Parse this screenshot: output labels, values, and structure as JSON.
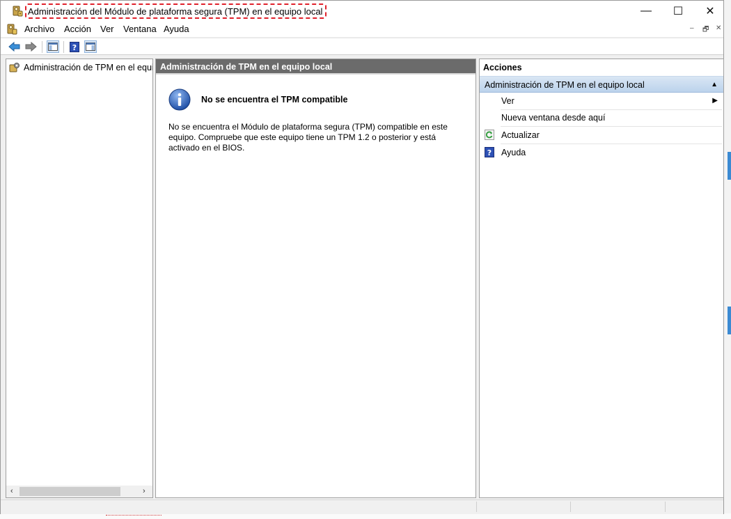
{
  "window": {
    "title": "Administración del Módulo de plataforma segura (TPM) en el equipo local",
    "controls": {
      "minimize": "—",
      "maximize": "☐",
      "close": "✕"
    }
  },
  "menu": {
    "items": [
      "Archivo",
      "Acción",
      "Ver",
      "Ventana",
      "Ayuda"
    ],
    "mdi": {
      "minimize": "–",
      "restore": "🗗",
      "close": "✕"
    }
  },
  "toolbar": {
    "icons": [
      "back-icon",
      "forward-icon",
      "show-hide-console-tree-icon",
      "help-icon",
      "show-hide-action-pane-icon"
    ]
  },
  "tree": {
    "root_label": "Administración de TPM en el equipo local",
    "scroll_left": "‹",
    "scroll_right": "›"
  },
  "center": {
    "header": "Administración de TPM en el equipo local",
    "info_title": "No se encuentra el TPM compatible",
    "info_body": "No se encuentra el Módulo de plataforma segura (TPM) compatible en este equipo. Compruebe que este equipo tiene un TPM 1.2 o posterior y está activado en el BIOS."
  },
  "actions": {
    "header": "Acciones",
    "group": "Administración de TPM en el equipo local",
    "items": [
      {
        "label": "Ver",
        "has_submenu": true
      },
      {
        "label": "Nueva ventana desde aquí",
        "has_submenu": false
      },
      {
        "label": "Actualizar",
        "icon": "refresh-icon"
      },
      {
        "label": "Ayuda",
        "icon": "help-icon"
      }
    ]
  },
  "colors": {
    "title_highlight": "#e0202a",
    "pane_header": "#6b6b6b",
    "actions_group": "#bcd3ec",
    "info_icon": "#2b5fb3"
  }
}
